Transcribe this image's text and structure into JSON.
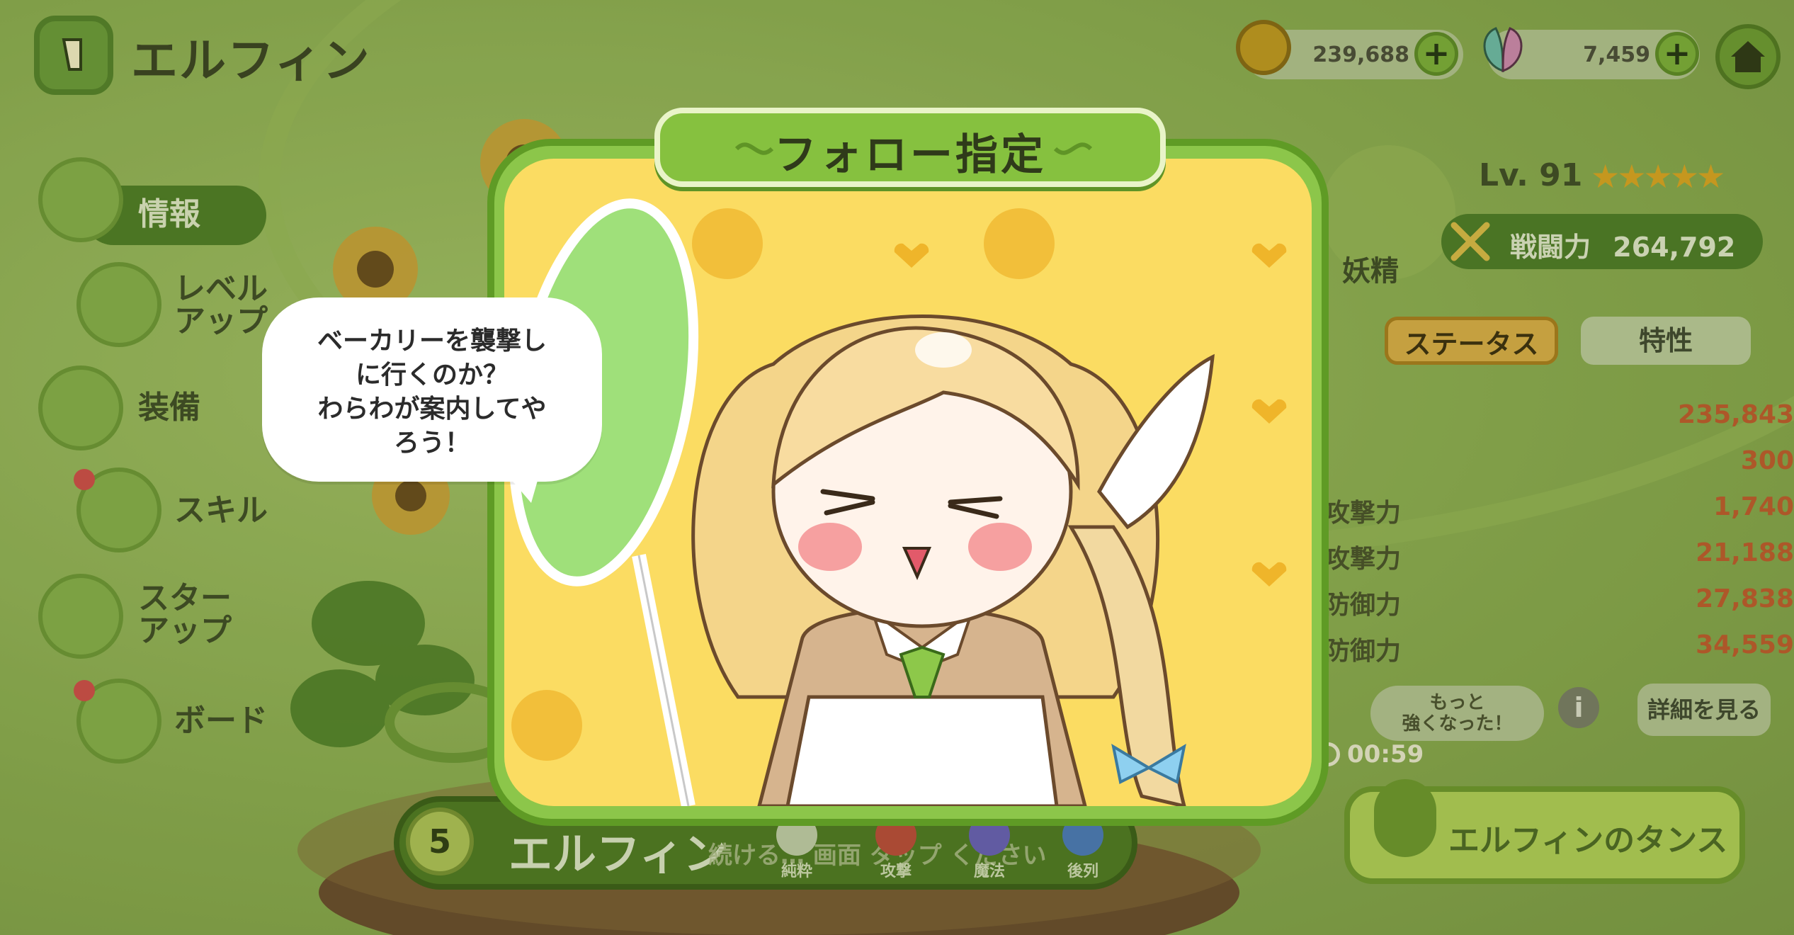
{
  "header": {
    "character_name": "エルフィン",
    "coins": "239,688",
    "gems": "7,459"
  },
  "nav": {
    "info": "情報",
    "levelup": "レベル\nアップ",
    "equip": "装備",
    "skill": "スキル",
    "starup": "スター\nアップ",
    "board": "ボード"
  },
  "panel": {
    "level": "Lv. 91",
    "stars": "★★★★★",
    "fairy_label": "妖精",
    "power_label": "戦闘力",
    "power_value": "264,792",
    "tab_status": "ステータス",
    "tab_trait": "特性",
    "stats": [
      {
        "label": "",
        "value": "235,843"
      },
      {
        "label": "",
        "value": "300"
      },
      {
        "label": "攻撃力",
        "value": "1,740"
      },
      {
        "label": "攻撃力",
        "value": "21,188"
      },
      {
        "label": "防御力",
        "value": "27,838"
      },
      {
        "label": "防御力",
        "value": "34,559"
      }
    ],
    "stronger_text": "もっと\n強くなった！",
    "info_symbol": "i",
    "details_button": "詳細を見る",
    "timer": "00:59",
    "dance_button": "エルフィンのタンス"
  },
  "bottom_bar": {
    "level": "5",
    "name": "エルフィン",
    "hint": "続ける… 画面 タップ  ください",
    "attributes": [
      "純粋",
      "攻撃",
      "魔法",
      "後列"
    ]
  },
  "modal": {
    "title": "フォロー指定",
    "speech": "ベーカリーを襲撃し\nに行くのか？\nわらわが案内してや\nろう！"
  },
  "colors": {
    "accent_green": "#86c13f",
    "dark_green": "#4f7a22",
    "stat_value": "#c65a2c",
    "modal_bg": "#fbdc62"
  }
}
